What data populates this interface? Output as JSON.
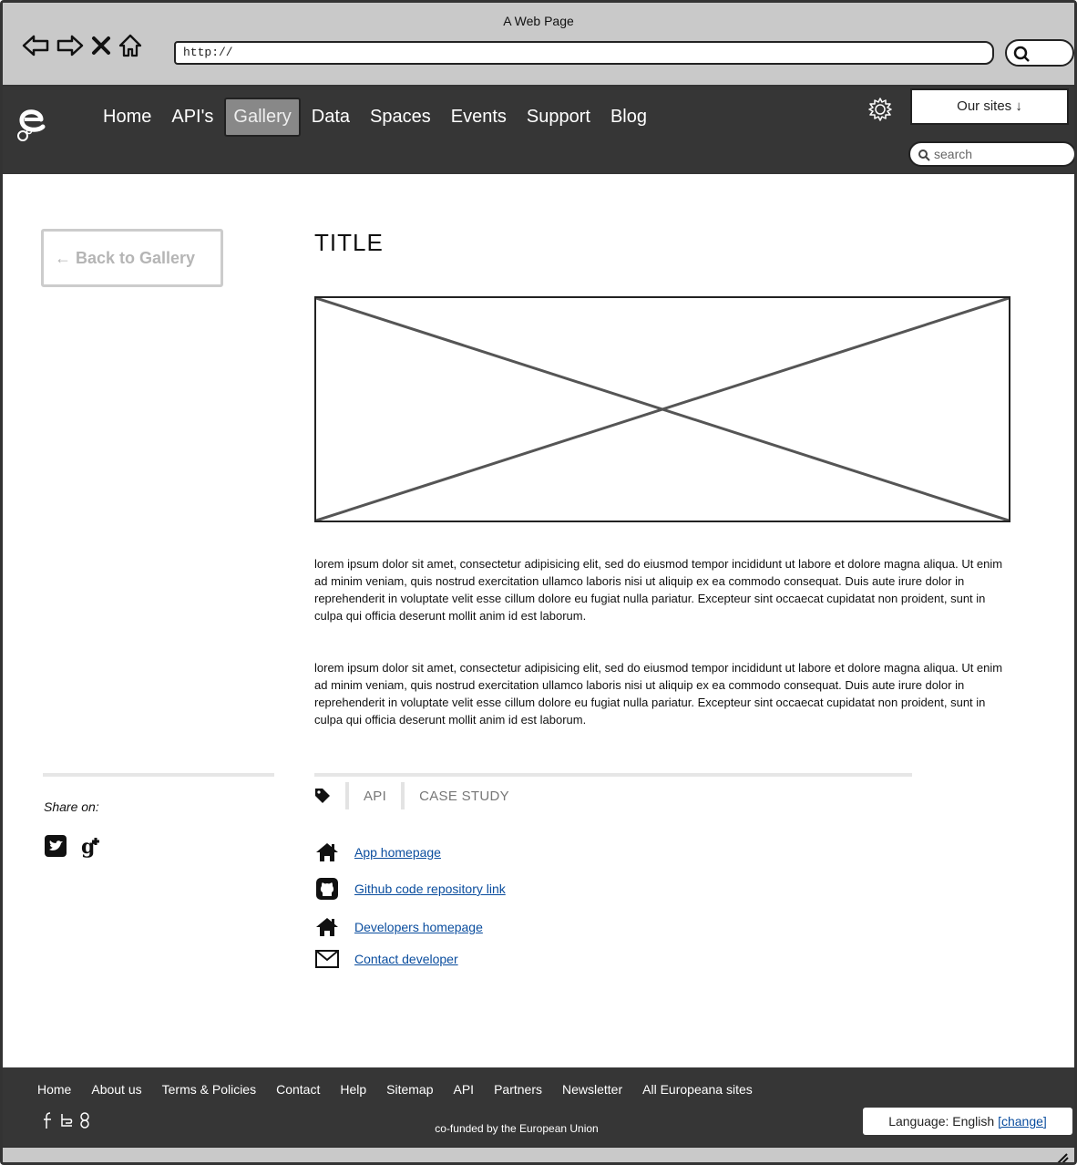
{
  "browser": {
    "window_title": "A Web Page",
    "url": "http://"
  },
  "header": {
    "nav": [
      "Home",
      "API's",
      "Gallery",
      "Data",
      "Spaces",
      "Events",
      "Support",
      "Blog"
    ],
    "active_nav": "Gallery",
    "our_sites_label": "Our sites ↓",
    "search_placeholder": "search"
  },
  "main": {
    "back_button": "← Back to Gallery",
    "title": "TITLE",
    "paragraphs": [
      "lorem ipsum dolor sit amet, consectetur adipisicing elit, sed do eiusmod tempor incididunt ut labore et dolore magna aliqua. Ut enim ad minim veniam, quis nostrud exercitation ullamco laboris nisi ut aliquip ex ea commodo consequat. Duis aute irure dolor in reprehenderit in voluptate velit esse cillum dolore eu fugiat nulla pariatur. Excepteur sint occaecat cupidatat non proident, sunt in culpa qui officia deserunt mollit anim id est laborum.",
      "lorem ipsum dolor sit amet, consectetur adipisicing elit, sed do eiusmod tempor incididunt ut labore et dolore magna aliqua. Ut enim ad minim veniam, quis nostrud exercitation ullamco laboris nisi ut aliquip ex ea commodo consequat. Duis aute irure dolor in reprehenderit in voluptate velit esse cillum dolore eu fugiat nulla pariatur. Excepteur sint occaecat cupidatat non proident, sunt in culpa qui officia deserunt mollit anim id est laborum."
    ],
    "tags": [
      "API",
      "CASE STUDY"
    ],
    "links": [
      {
        "icon": "home-icon",
        "label": "App homepage"
      },
      {
        "icon": "github-icon",
        "label": "Github code repository link"
      },
      {
        "icon": "home-icon",
        "label": "Developers homepage"
      },
      {
        "icon": "envelope-icon",
        "label": "Contact developer"
      }
    ]
  },
  "sidebar": {
    "share_label": "Share on:",
    "share_icons": [
      "twitter-icon",
      "google-plus-icon"
    ]
  },
  "footer": {
    "nav": [
      "Home",
      "About us",
      "Terms & Policies",
      "Contact",
      "Help",
      "Sitemap",
      "API",
      "Partners",
      "Newsletter",
      "All Europeana sites"
    ],
    "social_icons": [
      "facebook-icon",
      "twitter-icon",
      "google-plus-icon"
    ],
    "note": "co-funded by the European Union",
    "language_label": "Language: English ",
    "language_change": "[change]"
  },
  "colors": {
    "header_bg": "#363636",
    "link": "#0a4d9e",
    "chrome_bg": "#c9c9c9",
    "active_nav_bg": "#888888"
  }
}
